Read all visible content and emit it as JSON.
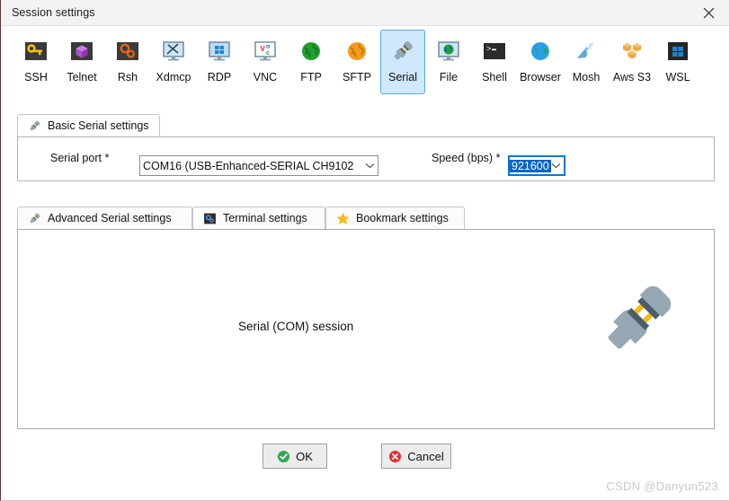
{
  "window": {
    "title": "Session settings",
    "close_label": "×"
  },
  "protocols": [
    {
      "label": "SSH",
      "icon": "ssh-key-icon",
      "selected": false
    },
    {
      "label": "Telnet",
      "icon": "telnet-cube-icon",
      "selected": false
    },
    {
      "label": "Rsh",
      "icon": "rsh-gears-icon",
      "selected": false
    },
    {
      "label": "Xdmcp",
      "icon": "xdmcp-monitor-icon",
      "selected": false
    },
    {
      "label": "RDP",
      "icon": "rdp-windows-icon",
      "selected": false
    },
    {
      "label": "VNC",
      "icon": "vnc-monitor-icon",
      "selected": false
    },
    {
      "label": "FTP",
      "icon": "ftp-globe-icon",
      "selected": false
    },
    {
      "label": "SFTP",
      "icon": "sftp-globe-icon",
      "selected": false
    },
    {
      "label": "Serial",
      "icon": "serial-plug-icon",
      "selected": true
    },
    {
      "label": "File",
      "icon": "file-monitor-icon",
      "selected": false
    },
    {
      "label": "Shell",
      "icon": "shell-terminal-icon",
      "selected": false
    },
    {
      "label": "Browser",
      "icon": "browser-globe-icon",
      "selected": false
    },
    {
      "label": "Mosh",
      "icon": "mosh-dish-icon",
      "selected": false
    },
    {
      "label": "Aws S3",
      "icon": "aws-s3-buckets-icon",
      "selected": false
    },
    {
      "label": "WSL",
      "icon": "wsl-windows-icon",
      "selected": false
    }
  ],
  "basic_tab": {
    "label": "Basic Serial settings",
    "icon": "serial-plug-icon"
  },
  "basic_settings": {
    "serial_port": {
      "label": "Serial port *",
      "value": "COM16  (USB-Enhanced-SERIAL CH9102",
      "arrow": "chevron-down-icon"
    },
    "speed": {
      "label": "Speed (bps) *",
      "value": "921600",
      "arrow": "chevron-down-icon"
    }
  },
  "lower_tabs": [
    {
      "label": "Advanced Serial settings",
      "icon": "serial-plug-icon",
      "active": false
    },
    {
      "label": "Terminal settings",
      "icon": "terminal-gears-icon",
      "active": false
    },
    {
      "label": "Bookmark settings",
      "icon": "star-icon",
      "active": false
    }
  ],
  "content": {
    "session_type": "Serial (COM) session",
    "illustration": "serial-plug-large-icon"
  },
  "buttons": {
    "ok": {
      "label": "OK",
      "icon": "check-circle-icon"
    },
    "cancel": {
      "label": "Cancel",
      "icon": "cross-circle-icon"
    }
  },
  "watermark": "CSDN @Danyun523",
  "colors": {
    "selection_blue": "#0a64c8",
    "focus_border": "#0078d7",
    "tab_selected_bg": "#cfe8fb",
    "ok_green": "#32a852",
    "cancel_red": "#e53030",
    "serial_yellow": "#f5b912",
    "serial_slate": "#4a5d68"
  }
}
